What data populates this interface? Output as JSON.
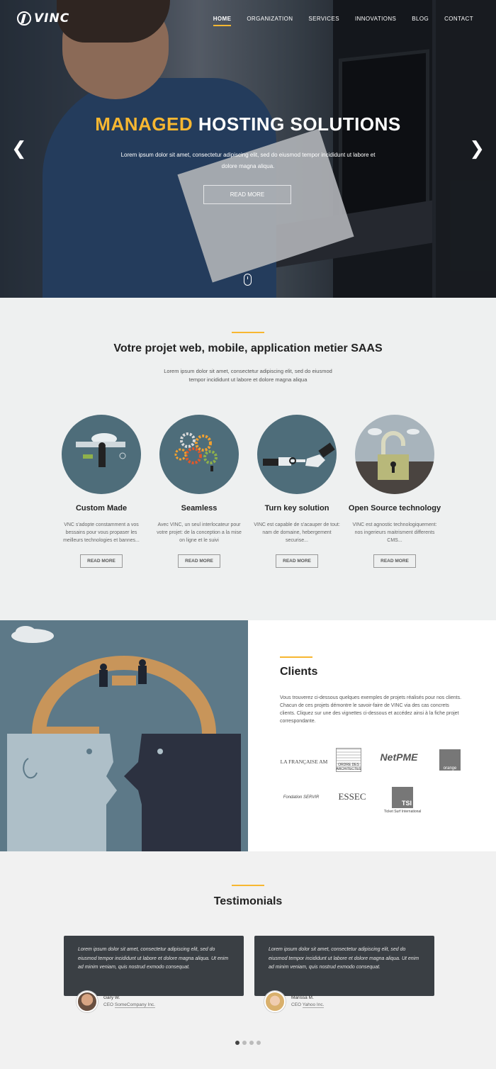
{
  "brand": {
    "name": "VINC"
  },
  "nav": {
    "items": [
      "HOME",
      "ORGANIZATION",
      "SERVICES",
      "INNOVATIONS",
      "BLOG",
      "CONTACT"
    ],
    "active": "HOME"
  },
  "hero": {
    "title_accent": "MANAGED",
    "title_rest": "HOSTING SOLUTIONS",
    "subtitle": "Lorem ipsum dolor sit amet, consectetur adipiscing elit, sed do eiusmod tempor incididunt ut labore et dolore magna aliqua.",
    "button": "READ MORE"
  },
  "services": {
    "title": "Votre projet web, mobile, application metier SAAS",
    "subtitle": "Lorem ipsum dolor sit amet, consectetur adipiscing elit, sed do eiusmod tempor incididunt ut labore et dolore magna aliqua",
    "items": [
      {
        "title": "Custom Made",
        "text": "VNC s'adopte constamment a vos bessains pour vous propaser les meilleurs technologies et bannes...",
        "button": "READ MORE"
      },
      {
        "title": "Seamless",
        "text": "Avec VINC, un seul interlocateur pour votre projet: de la conception a la mise on ligne et le suivi",
        "button": "READ MORE"
      },
      {
        "title": "Turn key solution",
        "text": "VINC est capable de s'acauper de tout: nam de domaine, hebergement securise...",
        "button": "READ MORE"
      },
      {
        "title": "Open Source technology",
        "text": "VINC est agnostic technologiquement: nos ingerieurs maitrisment differents CMS...",
        "button": "READ MORE"
      }
    ]
  },
  "clients": {
    "title": "Clients",
    "text": "Vous trouverez ci-dessous quelques exemples de projets réalisés pour nos clients. Chacun de ces projets démontre le savoir-faire de VINC via des cas concrets clients. Cliquez sur une des vignettes ci-dessous et accédez ainsi à la fiche projet correspondante.",
    "logos": [
      {
        "name": "LA FRANÇAISE AM"
      },
      {
        "name": "ORDRE DES ARCHITECTES"
      },
      {
        "name": "NetPME"
      },
      {
        "name": "orange"
      },
      {
        "name": "Fondation SERVIR"
      },
      {
        "name": "ESSEC"
      },
      {
        "name": "TSI",
        "sub": "Ticket Surf International"
      }
    ]
  },
  "testimonials": {
    "title": "Testimonials",
    "items": [
      {
        "quote": "Lorem ipsum dolor sit amet, consectetur adipiscing elit, sed do eiusmod tempor incididunt ut labore et dolore magna aliqua. Ut enim ad minim veniam, quis nostrud exmodo consequat.",
        "name": "Gary W.",
        "role_prefix": "CEO",
        "company": "SomeCompany Inc."
      },
      {
        "quote": "Lorem ipsum dolor sit amet, consectetur adipiscing elit, sed do eiusmod tempor incididunt ut labore et dolore magna aliqua. Ut enim ad minim veniam, quis nostrud exmodo consequat.",
        "name": "Marissa M.",
        "role_prefix": "CEO",
        "company": "Yahoo Inc."
      }
    ],
    "pager": {
      "count": 4,
      "active": 1
    }
  },
  "colors": {
    "accent": "#f7b731",
    "dark_card": "#3a3f44",
    "circle": "#4e6d7a"
  }
}
